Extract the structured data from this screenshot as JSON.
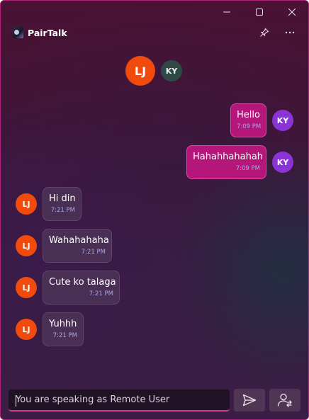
{
  "app": {
    "title": "PairTalk"
  },
  "header": {
    "primary_initials": "LJ",
    "secondary_initials": "KY"
  },
  "messages": [
    {
      "direction": "out",
      "text": "Hello",
      "time": "7:09 PM",
      "initials": "KY"
    },
    {
      "direction": "out",
      "text": "Hahahhahahah",
      "time": "7:09 PM",
      "initials": "KY"
    },
    {
      "direction": "in",
      "text": "Hi din",
      "time": "7:21 PM",
      "initials": "LJ"
    },
    {
      "direction": "in",
      "text": "Wahahahaha",
      "time": "7:21 PM",
      "initials": "LJ"
    },
    {
      "direction": "in",
      "text": "Cute ko talaga",
      "time": "7:21 PM",
      "initials": "LJ"
    },
    {
      "direction": "in",
      "text": "Yuhhh",
      "time": "7:21 PM",
      "initials": "LJ"
    }
  ],
  "composer": {
    "placeholder": "You are speaking as Remote User",
    "value": ""
  },
  "colors": {
    "outgoing_bubble": "#b4167a",
    "lj_avatar": "#f04a0c",
    "ky_avatar": "#8a34d6",
    "input_accent": "#d63a9a"
  },
  "icons": {
    "minimize": "minimize-icon",
    "maximize": "maximize-icon",
    "close": "close-icon",
    "pin": "pin-icon",
    "more": "more-icon",
    "send": "send-icon",
    "switch_user": "switch-user-icon"
  }
}
